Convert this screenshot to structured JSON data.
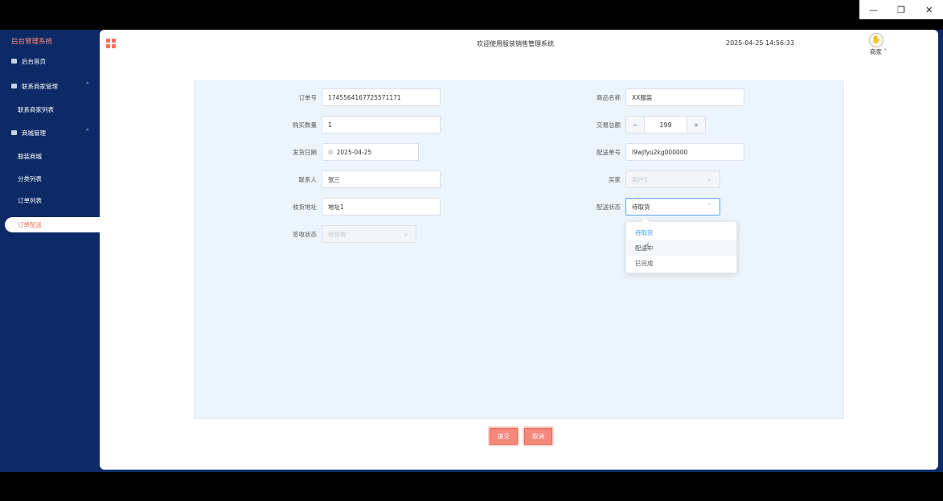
{
  "window": {
    "minimize": "—",
    "restore": "❐",
    "close": "✕"
  },
  "sidebar": {
    "brand": "后台管理系统",
    "items": [
      {
        "label": "后台首页"
      },
      {
        "label": "联系商家管理",
        "children": [
          "联系商家列表"
        ]
      },
      {
        "label": "商城管理",
        "children": [
          "服装商城",
          "分类列表",
          "订单列表"
        ]
      }
    ],
    "active": "订单配送"
  },
  "header": {
    "title": "欢迎使用服装销售管理系统",
    "datetime": "2025-04-25 14:56:33",
    "user": "商家"
  },
  "form": {
    "order_no": {
      "label": "订单号",
      "value": "1745564167725571171"
    },
    "product_name": {
      "label": "商品名称",
      "value": "XX服装"
    },
    "quantity": {
      "label": "购买数量",
      "value": "1"
    },
    "total": {
      "label": "交易总额",
      "value": "199",
      "minus": "−",
      "plus": "+"
    },
    "ship_date": {
      "label": "发货日期",
      "value": "2025-04-25"
    },
    "tracking_no": {
      "label": "配送单号",
      "value": "l9wjfyu2kg000000"
    },
    "contact": {
      "label": "联系人",
      "value": "张三"
    },
    "buyer": {
      "label": "买家",
      "value": "用户1"
    },
    "address": {
      "label": "收货地址",
      "value": "地址1"
    },
    "delivery_status": {
      "label": "配送状态",
      "value": "待取货",
      "options": [
        "待取货",
        "配送中",
        "已完成"
      ]
    },
    "receipt_status": {
      "label": "签收状态",
      "value": "待签收"
    }
  },
  "buttons": {
    "submit": "提交",
    "cancel": "取消"
  }
}
